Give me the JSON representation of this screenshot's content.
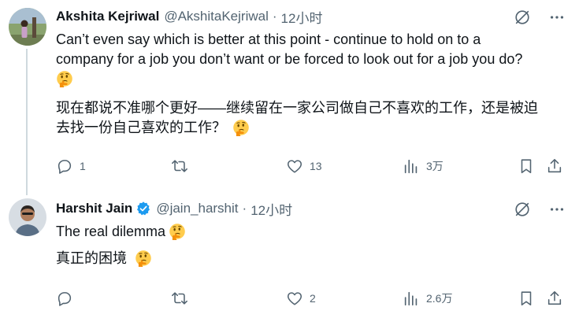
{
  "tweets": [
    {
      "author": "Akshita Kejriwal",
      "handle": "@AkshitaKejriwal",
      "dot": "·",
      "time": "12小时",
      "verified": false,
      "text_en_1": "Can’t even say which is better at this point - continue to hold on to a",
      "text_en_2": "company for a job you don’t want or be forced to look out for a job you do?",
      "text_zh_1": "现在都说不准哪个更好——继续留在一家公司做自己不喜欢的工作，还是被迫",
      "text_zh_2": "去找一份自己喜欢的工作？",
      "emoji_name": "thinking-face-emoji",
      "replies": "1",
      "retweets": "",
      "likes": "13",
      "views": "3万"
    },
    {
      "author": "Harshit Jain",
      "handle": "@jain_harshit",
      "dot": "·",
      "time": "12小时",
      "verified": true,
      "text_en": "The real dilemma",
      "text_zh": "真正的困境",
      "emoji_name": "thinking-face-emoji",
      "replies": "",
      "retweets": "",
      "likes": "2",
      "views": "2.6万"
    }
  ],
  "colors": {
    "text": "#0f1419",
    "secondary": "#536471",
    "verified": "#1d9bf0",
    "thread_line": "#cfd9de"
  },
  "icons": [
    "grok-icon",
    "more-icon",
    "reply-icon",
    "retweet-icon",
    "like-icon",
    "views-icon",
    "bookmark-icon",
    "share-icon"
  ]
}
